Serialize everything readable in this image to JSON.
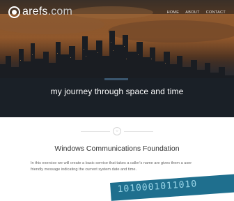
{
  "brand": {
    "name": "arefs",
    "tld": ".com"
  },
  "nav": {
    "items": [
      "HOME",
      "ABOUT",
      "CONTACT"
    ]
  },
  "hero": {
    "tagline": "my journey through space and time"
  },
  "divider": {
    "icon": "circle-dot-icon"
  },
  "section": {
    "title": "Windows Communications Foundation",
    "body": "In this exercise we will create a basic service that takes a caller's name are gives them a user friendly message indicating the current system date and time."
  },
  "banner": {
    "text": "1010001011010"
  },
  "colors": {
    "accent": "#1f6f8e",
    "text": "#333333",
    "muted": "#666666"
  }
}
